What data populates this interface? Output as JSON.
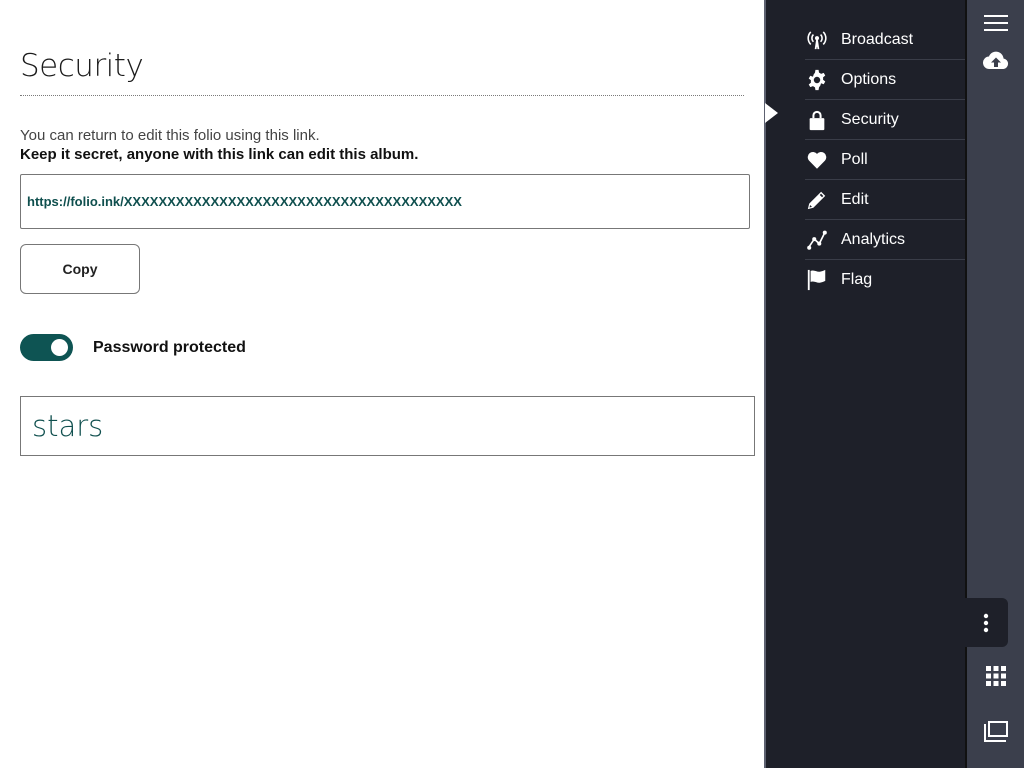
{
  "page": {
    "title": "Security",
    "info_text": "You can return to edit this folio using this link.",
    "warning_text": "Keep it secret, anyone with this link can edit this album.",
    "edit_link": "https://folio.ink/XXXXXXXXXXXXXXXXXXXXXXXXXXXXXXXXXXXXXXX",
    "copy_label": "Copy",
    "password_toggle": {
      "label": "Password protected",
      "checked": true
    },
    "password_value": "stars"
  },
  "menu": {
    "items": [
      {
        "label": "Broadcast",
        "icon": "broadcast-icon"
      },
      {
        "label": "Options",
        "icon": "gear-icon"
      },
      {
        "label": "Security",
        "icon": "lock-icon",
        "active": true
      },
      {
        "label": "Poll",
        "icon": "heart-icon"
      },
      {
        "label": "Edit",
        "icon": "pencil-icon"
      },
      {
        "label": "Analytics",
        "icon": "analytics-icon"
      },
      {
        "label": "Flag",
        "icon": "flag-icon"
      }
    ]
  },
  "rail": {
    "icons": [
      "hamburger-menu-icon",
      "cloud-upload-icon",
      "more-vertical-icon",
      "grid-icon",
      "windows-icon"
    ]
  },
  "colors": {
    "accent": "#0e5453",
    "panel_bg": "#1e2029",
    "rail_bg": "#3b3f4c"
  }
}
